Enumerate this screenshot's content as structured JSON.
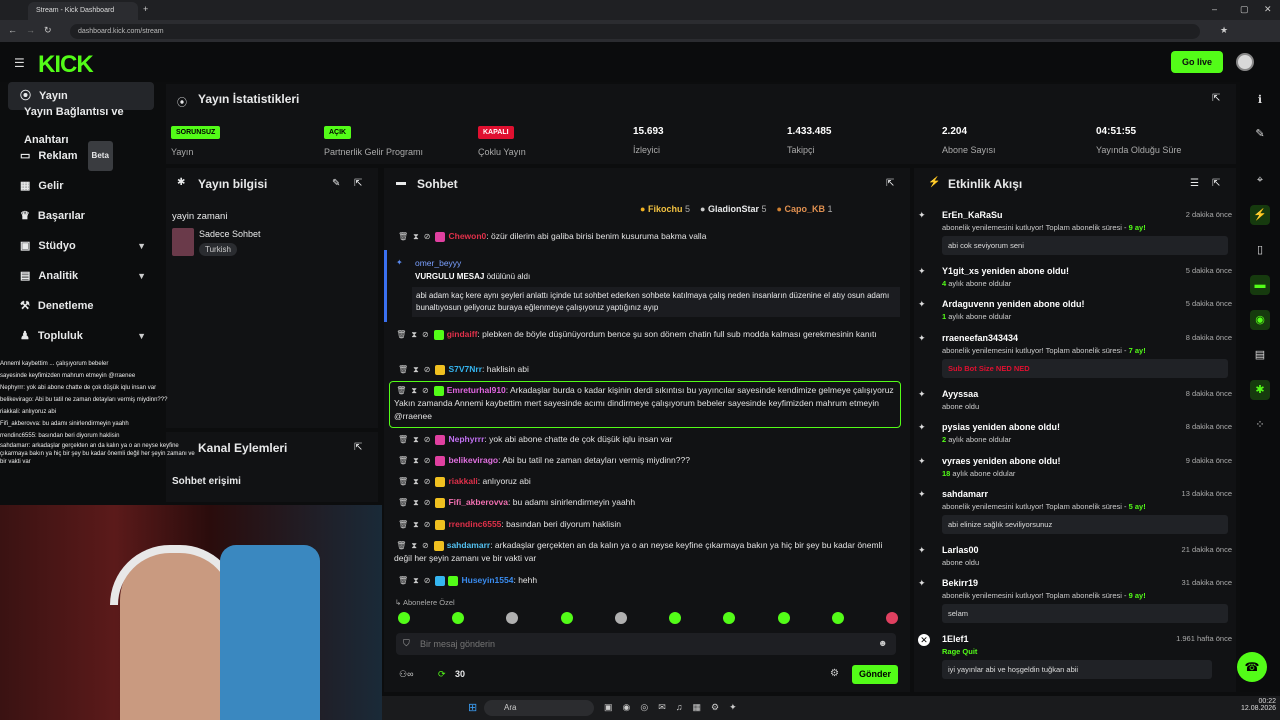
{
  "browser": {
    "tab_title": "Stream - Kick Dashboard",
    "url": "dashboard.kick.com/stream"
  },
  "header": {
    "logo": "KICK",
    "go_live": "Go live"
  },
  "sidebar": {
    "items": [
      {
        "label": "Yayın"
      },
      {
        "label": "Yayın Bağlantısı ve Anahtarı"
      },
      {
        "label": "Reklam",
        "badge": "Beta"
      },
      {
        "label": "Gelir"
      },
      {
        "label": "Başarılar"
      },
      {
        "label": "Stüdyo"
      },
      {
        "label": "Analitik"
      },
      {
        "label": "Denetleme"
      },
      {
        "label": "Topluluk"
      }
    ]
  },
  "stats": {
    "title": "Yayın İstatistikleri",
    "items": [
      {
        "badge": "SORUNSUZ",
        "label": "Yayın"
      },
      {
        "badge": "AÇIK",
        "label": "Partnerlik Gelir Programı"
      },
      {
        "badge": "KAPALI",
        "label": "Çoklu Yayın"
      },
      {
        "value": "15.693",
        "label": "İzleyici"
      },
      {
        "value": "1.433.485",
        "label": "Takipçi"
      },
      {
        "value": "2.204",
        "label": "Abone Sayısı"
      },
      {
        "value": "04:51:55",
        "label": "Yayında Olduğu Süre"
      }
    ]
  },
  "info": {
    "title": "Yayın bilgisi",
    "stream_title": "yayin zamani",
    "category": "Sadece Sohbet",
    "language": "Turkish"
  },
  "channel": {
    "title": "Kanal Eylemleri",
    "item": "Sohbet erişimi"
  },
  "chat": {
    "title": "Sohbet",
    "top": [
      {
        "name": "Fikochu",
        "n": "5"
      },
      {
        "name": "GladionStar",
        "n": "5"
      },
      {
        "name": "Capo_KB",
        "n": "1"
      }
    ],
    "pinned": {
      "user": "omer_beyyy",
      "action": "VURGULU MESAJ ödülünü aldı",
      "text": "abi adam kaç kere aynı şeyleri anlattı içinde tut sohbet ederken sohbete katılmaya çalış neden insanların düzenine el atıy osun adamı bunaltıyosun geliyoruz buraya eğlenmeye çalışıyoruz yaptığınız ayıp"
    },
    "messages": [
      {
        "user": "Chewon0",
        "color": "#e0304a",
        "text": "özür dilerim abi galiba birisi benim kusuruma bakma valla"
      },
      {
        "user": "gindaiff",
        "color": "#e0304a",
        "text": "plebken de böyle düşünüyordum bence şu son dönem chatin full sub modda kalması gerekmesinin kanıtı"
      },
      {
        "user": "S7V7Nrr",
        "color": "#35b5f0",
        "text": "haklisin abi"
      },
      {
        "user": "Emreturhal910",
        "color": "#e066e0",
        "text": "Arkadaşlar burda o kadar kişinin derdi sıkıntısı bu yayıncılar sayesinde kendimize gelmeye çalışıyoruz Yakın zamanda Annemi kaybettim mert sayesinde acımı dindirmeye çalışıyorum bebeler sayesinde keyfimizden mahrum etmeyin @rraenee"
      },
      {
        "user": "Nephyrrr",
        "color": "#c070f0",
        "text": "yok abi abone chatte de çok düşük iqlu insan var"
      },
      {
        "user": "belikevirago",
        "color": "#e070e0",
        "text": "Abi bu tatil ne zaman detayları vermiş miydinn???"
      },
      {
        "user": "riakkali",
        "color": "#e0304a",
        "text": "anlıyoruz abi"
      },
      {
        "user": "Fifi_akberovva",
        "color": "#f070b0",
        "text": "bu adamı sinirlendirmeyin yaahh"
      },
      {
        "user": "rrendinc6555",
        "color": "#e0304a",
        "text": "basından beri diyorum haklisin"
      },
      {
        "user": "sahdamarr",
        "color": "#53c0f0",
        "text": "arkadaşlar gerçekten an da kalın ya o an neyse keyfine çıkarmaya bakın ya hiç bir şey bu kadar önemli değil her şeyin zamanı ve bir vakti var"
      },
      {
        "user": "Huseyin1554",
        "color": "#3a8cf0",
        "text": "hehh"
      }
    ],
    "emotes_label": "Abonelere Özel",
    "input_placeholder": "Bir mesaj gönderin",
    "points": "30",
    "send": "Gönder"
  },
  "events": {
    "title": "Etkinlik Akışı",
    "items": [
      {
        "name": "ErEn_KaRaSu",
        "time": "2 dakika önce",
        "sub": "abonelik yenilemesini kutluyor! Toplam abonelik süresi - ",
        "months": "9 ay!",
        "msg": "abi cok seviyorum seni"
      },
      {
        "name": "Y1git_xs yeniden abone oldu!",
        "time": "5 dakika önce",
        "months": "4",
        "sub": " aylık abone oldular"
      },
      {
        "name": "Ardaguvenn yeniden abone oldu!",
        "time": "5 dakika önce",
        "months": "1",
        "sub": " aylık abone oldular"
      },
      {
        "name": "rraeneefan343434",
        "time": "8 dakika önce",
        "sub": "abonelik yenilemesini kutluyor! Toplam abonelik süresi - ",
        "months": "7 ay!",
        "msg": "Sub Bot Size NED NED"
      },
      {
        "name": "Ayyssaa",
        "time": "8 dakika önce",
        "sub": "abone oldu"
      },
      {
        "name": "pysias yeniden abone oldu!",
        "time": "8 dakika önce",
        "months": "2",
        "sub": " aylık abone oldular"
      },
      {
        "name": "vyraes yeniden abone oldu!",
        "time": "9 dakika önce",
        "months": "18",
        "sub": " aylık abone oldular"
      },
      {
        "name": "sahdamarr",
        "time": "13 dakika önce",
        "sub": "abonelik yenilemesini kutluyor! Toplam abonelik süresi - ",
        "months": "5 ay!",
        "msg": "abi elinize sağlık seviliyorsunuz"
      },
      {
        "name": "Larlas00",
        "time": "21 dakika önce",
        "sub": "abone oldu"
      },
      {
        "name": "Bekirr19",
        "time": "31 dakika önce",
        "sub": "abonelik yenilemesini kutluyor! Toplam abonelik süresi - ",
        "months": "9 ay!",
        "msg": "selam"
      },
      {
        "name": "1Elef1",
        "time": "1.961 hafta önce",
        "sub": "Rage Quit",
        "msg": "iyi yayınlar abi ve hoşgeldin tuğkan abii"
      }
    ]
  },
  "overlay_chat": [
    "Anneml kaybettim ... çalışıyorum bebeler",
    "sayesinde keyfimizden mahrum etmeyin @rraenee",
    "Nephyrrr: yok abi abone chatte de çok düşük iqlu insan var",
    "belikevirago: Abi bu tatil ne zaman detayları vermiş miydinn???",
    "riakkali: anlıyoruz abi",
    "Fifi_akberovva: bu adamı sinirlendirmeyin yaahh",
    "rrendinc6555: basından beri diyorum haklisin",
    "sahdamarr: arkadaşlar gerçekten an da kalın ya o an neyse keyfine",
    "çıkarmaya bakın ya hiç bir şey bu kadar önemli değil her şeyin zamanı ve",
    "bir vakti var"
  ],
  "taskbar": {
    "search": "Ara",
    "time": "00:22",
    "date": "12.08.2026"
  },
  "colors": {
    "accent": "#53fc18",
    "panel": "#111214",
    "bg": "#0c0d0e"
  }
}
